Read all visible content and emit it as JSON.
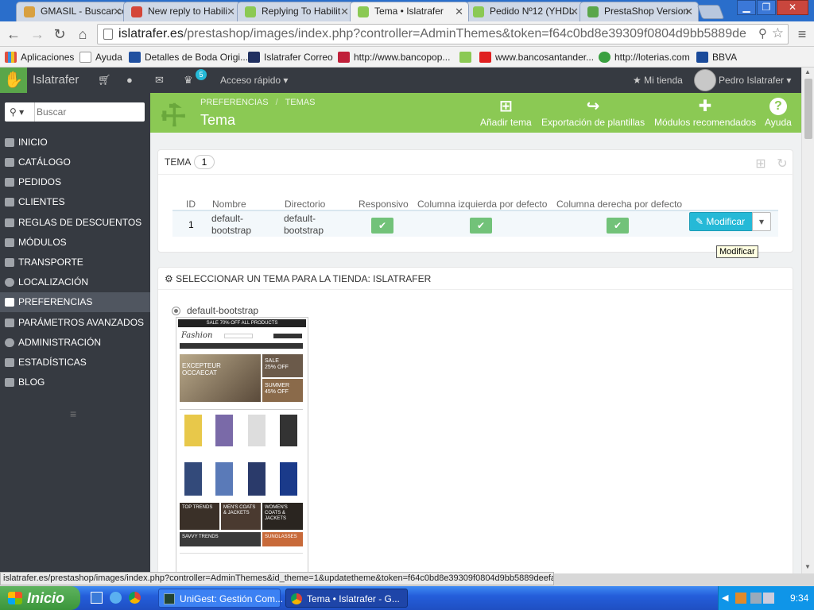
{
  "browser": {
    "tabs": [
      {
        "title": "GMASIL - Buscar co",
        "color": "#d8a040"
      },
      {
        "title": "New reply to Habili",
        "color": "#d44638"
      },
      {
        "title": "Replying To Habilit",
        "color": "#8bc954"
      },
      {
        "title": "Tema • Islatrafer",
        "color": "#8bc954",
        "active": true
      },
      {
        "title": "Pedido Nº12 (YHDL",
        "color": "#8bc954"
      },
      {
        "title": "PrestaShop Version",
        "color": "#5aa64a"
      }
    ],
    "url_host": "islatrafer.es",
    "url_path": "/prestashop/images/index.php?controller=AdminThemes&token=f64c0bd8e39309f0804d9bb5889de",
    "bookmarks": [
      {
        "label": "Aplicaciones",
        "color": "#e05040"
      },
      {
        "label": "Ayuda",
        "color": "#ffffff"
      },
      {
        "label": "Detalles de Boda Origi...",
        "color": "#2050a0"
      },
      {
        "label": "Islatrafer Correo",
        "color": "#203060"
      },
      {
        "label": "http://www.bancopop...",
        "color": "#c0203a"
      },
      {
        "label": "",
        "color": "#8bc954"
      },
      {
        "label": "www.bancosantander...",
        "color": "#e02020"
      },
      {
        "label": "http://loterias.com",
        "color": "#3aa040"
      },
      {
        "label": "BBVA",
        "color": "#1a4a9a"
      }
    ],
    "status_url": "islatrafer.es/prestashop/images/index.php?controller=AdminThemes&id_theme=1&updatetheme&token=f64c0bd8e39309f0804d9bb5889deefa"
  },
  "header": {
    "shop_name": "Islatrafer",
    "notification_count": "5",
    "quick_access": "Acceso rápido",
    "my_shop": "Mi tienda",
    "user_name": "Pedro Islatrafer"
  },
  "sidebar": {
    "search_placeholder": "Buscar",
    "items": [
      {
        "label": "INICIO"
      },
      {
        "label": "CATÁLOGO"
      },
      {
        "label": "PEDIDOS"
      },
      {
        "label": "CLIENTES"
      },
      {
        "label": "REGLAS DE DESCUENTOS"
      },
      {
        "label": "MÓDULOS"
      },
      {
        "label": "TRANSPORTE"
      },
      {
        "label": "LOCALIZACIÓN"
      },
      {
        "label": "PREFERENCIAS",
        "active": true
      },
      {
        "label": "PARÁMETROS AVANZADOS"
      },
      {
        "label": "ADMINISTRACIÓN"
      },
      {
        "label": "ESTADÍSTICAS"
      },
      {
        "label": "BLOG"
      }
    ]
  },
  "page_header": {
    "breadcrumb_1": "PREFERENCIAS",
    "breadcrumb_2": "TEMAS",
    "title": "Tema",
    "buttons": {
      "add_theme": "Añadir tema",
      "export_templates": "Exportación de plantillas",
      "recommended_modules": "Módulos recomendados",
      "help": "Ayuda"
    }
  },
  "theme_list": {
    "title": "TEMA",
    "count": "1",
    "columns": {
      "id": "ID",
      "name": "Nombre",
      "directory": "Directorio",
      "responsive": "Responsivo",
      "left_column": "Columna izquierda por defecto",
      "right_column": "Columna derecha por defecto"
    },
    "row": {
      "id": "1",
      "name_line1": "default-",
      "name_line2": "bootstrap",
      "dir_line1": "default-",
      "dir_line2": "bootstrap",
      "responsive": true,
      "left_column": true,
      "right_column": true
    },
    "edit_label": "Modificar",
    "tooltip": "Modificar"
  },
  "select_theme": {
    "title": "SELECCIONAR UN TEMA PARA LA TIENDA: ISLATRAFER",
    "option_label": "default-bootstrap",
    "preview": {
      "banner": "SALE 70% OFF ALL PRODUCTS",
      "logo": "Fashion",
      "hero_1": "EXCEPTEUR OCCAECAT",
      "hero_2": "SALE 25% OFF",
      "hero_3": "SUMMER 45% OFF",
      "tile_1": "TOP TRENDS",
      "tile_2": "MEN'S COATS & JACKETS",
      "tile_3": "WOMEN'S COATS & JACKETS",
      "tile_4": "SAVVY TRENDS",
      "tile_5": "SUNGLASSES"
    }
  },
  "taskbar": {
    "start": "Inicio",
    "task_1": "UniGest: Gestión Com...",
    "task_2": "Tema • Islatrafer - G...",
    "clock": "9:34"
  }
}
